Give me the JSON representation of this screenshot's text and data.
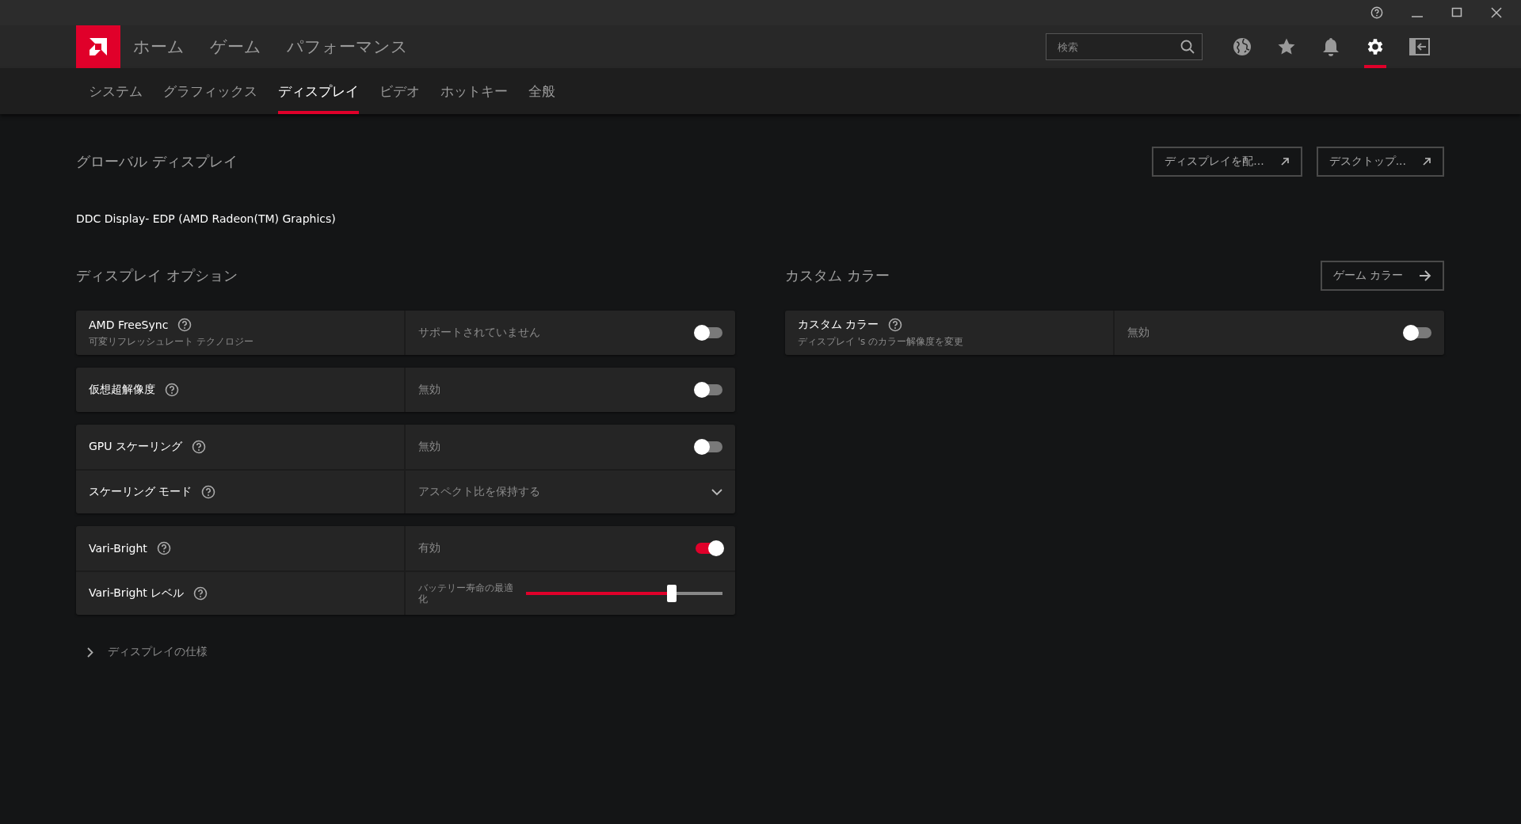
{
  "nav": {
    "items": [
      {
        "label": "ホーム",
        "selected": false
      },
      {
        "label": "ゲーム",
        "selected": false
      },
      {
        "label": "パフォーマンス",
        "selected": false
      }
    ]
  },
  "search": {
    "placeholder": "検索"
  },
  "toolbar_icons": [
    {
      "kind": "globe",
      "selected": false
    },
    {
      "kind": "star",
      "selected": false
    },
    {
      "kind": "bell",
      "selected": false
    },
    {
      "kind": "settings",
      "selected": true
    },
    {
      "kind": "panel",
      "selected": false
    }
  ],
  "tabs": [
    {
      "label": "システム",
      "selected": false
    },
    {
      "label": "グラフィックス",
      "selected": false
    },
    {
      "label": "ディスプレイ",
      "selected": true
    },
    {
      "label": "ビデオ",
      "selected": false
    },
    {
      "label": "ホットキー",
      "selected": false
    },
    {
      "label": "全般",
      "selected": false
    }
  ],
  "page": {
    "title": "グローバル ディスプレイ",
    "actions": [
      {
        "label": "ディスプレイを配...",
        "kind": "external"
      },
      {
        "label": "デスクトップ...",
        "kind": "external"
      }
    ],
    "display_name": "DDC Display- EDP (AMD Radeon(TM) Graphics)"
  },
  "display_options": {
    "title": "ディスプレイ オプション",
    "groups": [
      {
        "rows": [
          {
            "kind": "toggle",
            "label": "AMD FreeSync",
            "sublabel": "可変リフレッシュレート テクノロジー",
            "value": "サポートされていません",
            "on": false
          }
        ]
      },
      {
        "rows": [
          {
            "kind": "toggle",
            "label": "仮想超解像度",
            "value": "無効",
            "on": false
          }
        ]
      },
      {
        "rows": [
          {
            "kind": "toggle",
            "label": "GPU スケーリング",
            "value": "無効",
            "on": false
          },
          {
            "kind": "dropdown",
            "label": "スケーリング モード",
            "value": "アスペクト比を保持する"
          }
        ]
      },
      {
        "rows": [
          {
            "kind": "toggle",
            "label": "Vari-Bright",
            "value": "有効",
            "on": true
          },
          {
            "kind": "slider",
            "label": "Vari-Bright レベル",
            "value": "バッテリー寿命の最適化",
            "level": 0.74
          }
        ]
      }
    ]
  },
  "custom_color": {
    "title": "カスタム カラー",
    "action": {
      "label": "ゲーム カラー",
      "kind": "forward"
    },
    "groups": [
      {
        "rows": [
          {
            "kind": "toggle",
            "label": "カスタム カラー",
            "sublabel": "ディスプレイ 's のカラー解像度を変更",
            "value": "無効",
            "on": false
          }
        ]
      }
    ]
  },
  "specs": {
    "label": "ディスプレイの仕様",
    "expanded": false
  }
}
